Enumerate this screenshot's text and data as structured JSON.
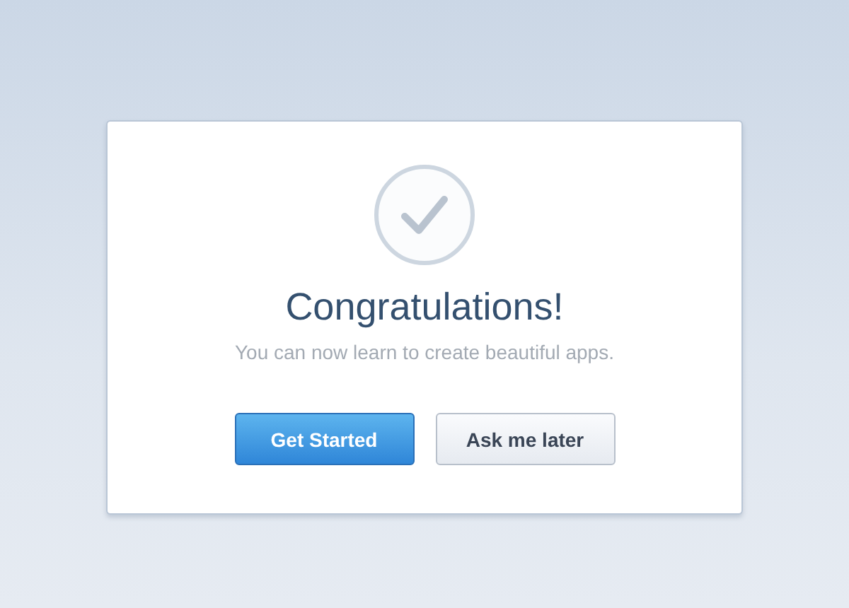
{
  "dialog": {
    "title": "Congratulations!",
    "message": "You can now learn to create beautiful apps.",
    "buttons": [
      {
        "label": "Get Started",
        "kind": "primary"
      },
      {
        "label": "Ask me later",
        "kind": "secondary"
      }
    ]
  }
}
